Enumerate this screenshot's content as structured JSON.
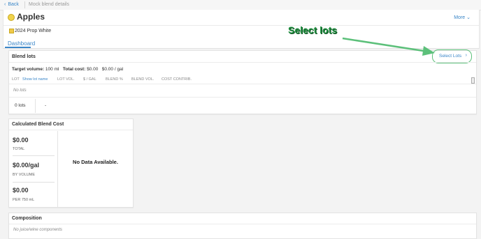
{
  "topbar": {
    "back_label": "Back",
    "breadcrumb": "Mock blend details"
  },
  "header": {
    "title": "Apples",
    "more_label": "More",
    "subtitle": "2024 Prop White"
  },
  "tabs": [
    {
      "label": "Dashboard",
      "active": true
    }
  ],
  "blend_lots": {
    "title": "Blend lots",
    "select_lots_label": "Select Lots",
    "target_volume_label": "Target volume:",
    "target_volume_value": "100 ml",
    "total_cost_label": "Total cost:",
    "total_cost_value": "$0.00",
    "per_gal": "$0.00 / gal",
    "columns": [
      "LOT",
      "Show lot name",
      "LOT VOL.",
      "$ / GAL",
      "BLEND %",
      "BLEND VOL.",
      "COST CONTRIB."
    ],
    "empty_text": "No lots",
    "footer_count": "0 lots",
    "footer_dash": "-"
  },
  "calculated_cost": {
    "title": "Calculated Blend Cost",
    "items": [
      {
        "value": "$0.00",
        "label": "TOTAL"
      },
      {
        "value": "$0.00/gal",
        "label": "BY VOLUME"
      },
      {
        "value": "$0.00",
        "label": "PER 750 mL"
      }
    ],
    "no_data": "No Data Available."
  },
  "composition": {
    "title": "Composition",
    "empty_text": "No juice/wine components"
  },
  "annotation": {
    "text": "Select lots",
    "color": "#1f8d3f"
  },
  "colors": {
    "accent": "#3a86c8",
    "highlight": "#5cc07a"
  }
}
